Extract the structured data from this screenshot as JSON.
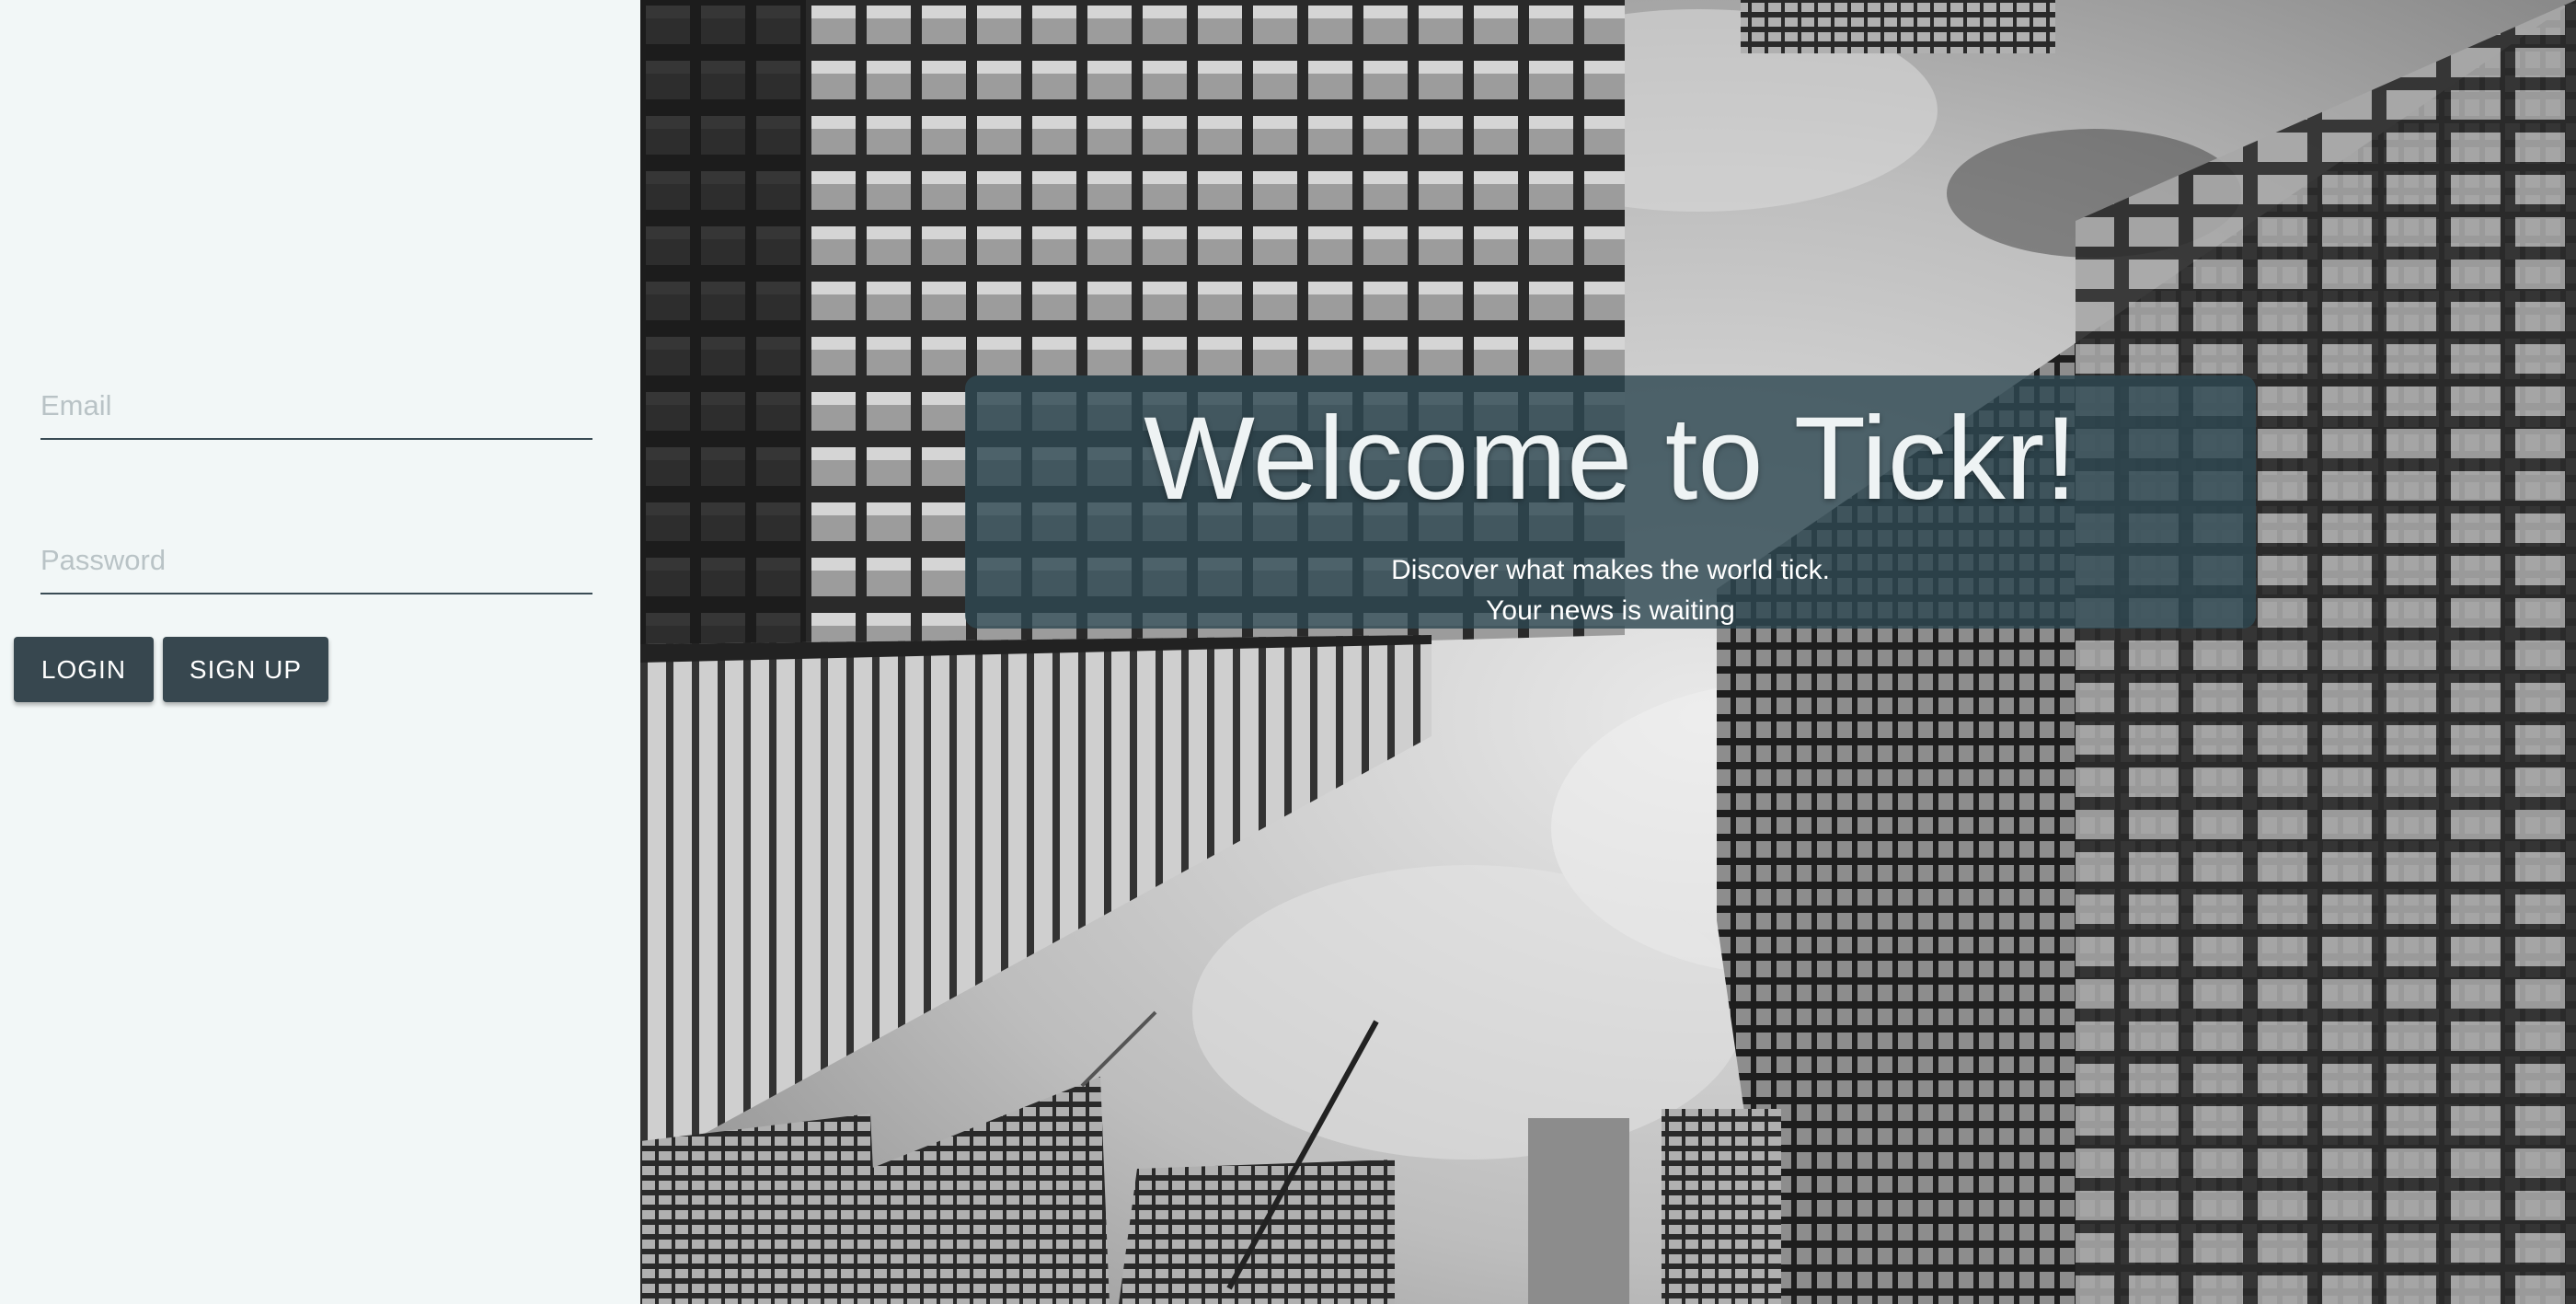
{
  "login": {
    "email_placeholder": "Email",
    "password_placeholder": "Password",
    "login_label": "LOGIN",
    "signup_label": "SIGN UP"
  },
  "hero": {
    "title": "Welcome to Tickr!",
    "subtitle_line1": "Discover what makes the world tick.",
    "subtitle_line2": "Your news is waiting",
    "background": "grayscale-skyscrapers-photo"
  },
  "colors": {
    "panel_bg": "#f2f7f7",
    "button_bg": "#37474f",
    "overlay_bg": "#2e4852"
  }
}
